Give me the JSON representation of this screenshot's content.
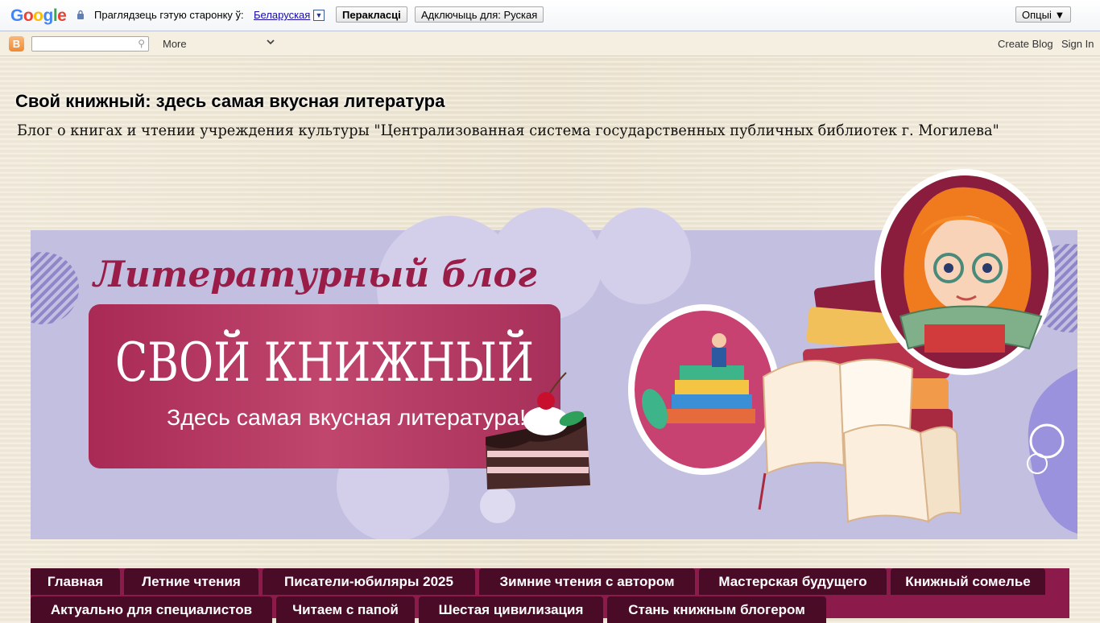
{
  "translate_bar": {
    "logo": "Google",
    "prompt": "Праглядзець гэтую старонку ў:",
    "language": "Беларуская",
    "translate_button": "Перакласці",
    "disable_button": "Адключыць для: Руская",
    "options_button": "Опцыі ▼"
  },
  "navbar": {
    "search_placeholder": "",
    "more": "More",
    "create_blog": "Create Blog",
    "sign_in": "Sign In"
  },
  "header": {
    "title": "Свой книжный: здесь самая вкусная литература",
    "description": "Блог о книгах и чтении учреждения культуры \"Централизованная система государственных публичных библиотек г. Могилева\""
  },
  "banner": {
    "script_title": "Литературный блог",
    "main_title": "СВОЙ КНИЖНЫЙ",
    "subtitle": "Здесь самая вкусная литература!"
  },
  "menu": {
    "row1": [
      "Главная",
      "Летние чтения",
      "Писатели-юбиляры 2025",
      "Зимние чтения с автором",
      "Мастерская будущего",
      "Книжный сомелье"
    ],
    "row2": [
      "Актуально для специалистов",
      "Читаем с папой",
      "Шестая цивилизация",
      "Стань книжным блогером"
    ]
  },
  "colors": {
    "menu_bg": "#8c1a4b",
    "menu_tab": "#4a0b27",
    "banner_bg": "#c3bfe0",
    "banner_card": "#b2385f"
  }
}
